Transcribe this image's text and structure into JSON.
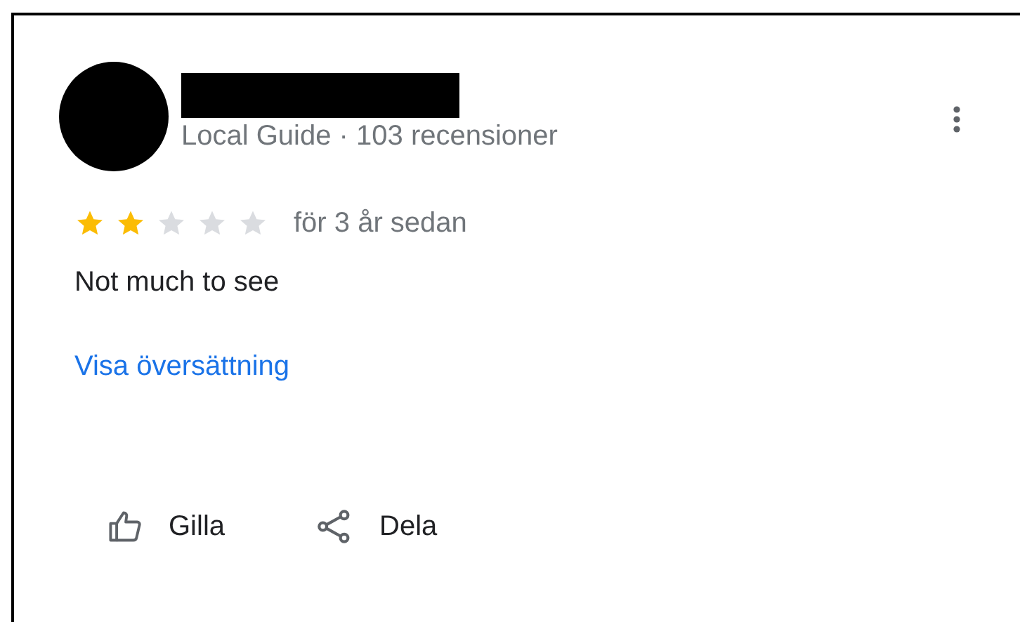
{
  "review": {
    "subtitle": "Local Guide · 103 recensioner",
    "stars": 2,
    "time": "för 3 år sedan",
    "text": "Not much to see",
    "translate_link": "Visa översättning"
  },
  "actions": [
    {
      "kind": "like",
      "label": "Gilla"
    },
    {
      "kind": "share",
      "label": "Dela"
    }
  ]
}
